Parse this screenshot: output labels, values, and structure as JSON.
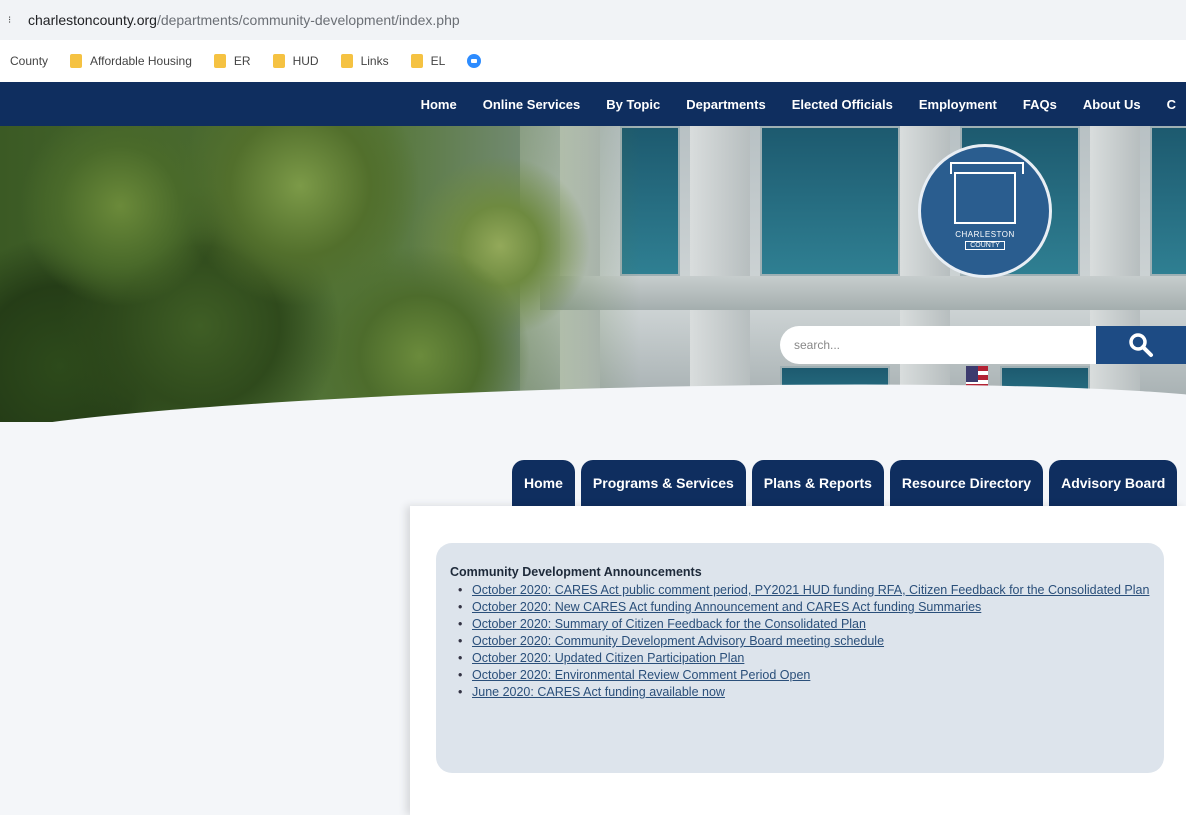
{
  "browser": {
    "url_domain": "charlestoncounty.org",
    "url_path": "/departments/community-development/index.php",
    "bookmarks": [
      "County",
      "Affordable Housing",
      "ER",
      "HUD",
      "Links",
      "EL"
    ]
  },
  "topnav": {
    "items": [
      "Home",
      "Online Services",
      "By Topic",
      "Departments",
      "Elected Officials",
      "Employment",
      "FAQs",
      "About Us",
      "C"
    ]
  },
  "hero": {
    "seal_line1": "CHARLESTON",
    "seal_line2": "COUNTY",
    "search_placeholder": "search..."
  },
  "tabs": [
    "Home",
    "Programs & Services",
    "Plans & Reports",
    "Resource Directory",
    "Advisory Board"
  ],
  "announcements": {
    "title": "Community Development Announcements",
    "items": [
      "October 2020: CARES Act public comment period, PY2021 HUD funding RFA, Citizen Feedback for the Consolidated Plan",
      "October 2020: New CARES Act funding Announcement and CARES Act funding Summaries",
      "October 2020: Summary of Citizen Feedback for the Consolidated Plan",
      "October 2020: Community Development Advisory Board meeting schedule",
      "October 2020: Updated Citizen Participation Plan",
      "October 2020: Environmental Review Comment Period Open",
      "June 2020: CARES Act funding available now"
    ]
  }
}
